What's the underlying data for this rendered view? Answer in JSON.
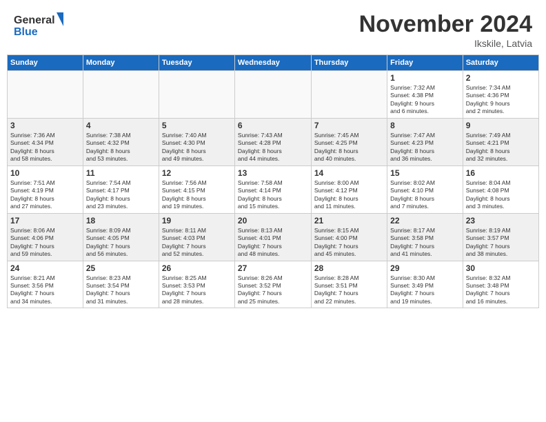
{
  "header": {
    "logo_line1": "General",
    "logo_line2": "Blue",
    "month": "November 2024",
    "location": "Ikskile, Latvia"
  },
  "weekdays": [
    "Sunday",
    "Monday",
    "Tuesday",
    "Wednesday",
    "Thursday",
    "Friday",
    "Saturday"
  ],
  "weeks": [
    [
      {
        "day": "",
        "detail": "",
        "empty": true
      },
      {
        "day": "",
        "detail": "",
        "empty": true
      },
      {
        "day": "",
        "detail": "",
        "empty": true
      },
      {
        "day": "",
        "detail": "",
        "empty": true
      },
      {
        "day": "",
        "detail": "",
        "empty": true
      },
      {
        "day": "1",
        "detail": "Sunrise: 7:32 AM\nSunset: 4:38 PM\nDaylight: 9 hours\nand 6 minutes."
      },
      {
        "day": "2",
        "detail": "Sunrise: 7:34 AM\nSunset: 4:36 PM\nDaylight: 9 hours\nand 2 minutes."
      }
    ],
    [
      {
        "day": "3",
        "detail": "Sunrise: 7:36 AM\nSunset: 4:34 PM\nDaylight: 8 hours\nand 58 minutes."
      },
      {
        "day": "4",
        "detail": "Sunrise: 7:38 AM\nSunset: 4:32 PM\nDaylight: 8 hours\nand 53 minutes."
      },
      {
        "day": "5",
        "detail": "Sunrise: 7:40 AM\nSunset: 4:30 PM\nDaylight: 8 hours\nand 49 minutes."
      },
      {
        "day": "6",
        "detail": "Sunrise: 7:43 AM\nSunset: 4:28 PM\nDaylight: 8 hours\nand 44 minutes."
      },
      {
        "day": "7",
        "detail": "Sunrise: 7:45 AM\nSunset: 4:25 PM\nDaylight: 8 hours\nand 40 minutes."
      },
      {
        "day": "8",
        "detail": "Sunrise: 7:47 AM\nSunset: 4:23 PM\nDaylight: 8 hours\nand 36 minutes."
      },
      {
        "day": "9",
        "detail": "Sunrise: 7:49 AM\nSunset: 4:21 PM\nDaylight: 8 hours\nand 32 minutes."
      }
    ],
    [
      {
        "day": "10",
        "detail": "Sunrise: 7:51 AM\nSunset: 4:19 PM\nDaylight: 8 hours\nand 27 minutes."
      },
      {
        "day": "11",
        "detail": "Sunrise: 7:54 AM\nSunset: 4:17 PM\nDaylight: 8 hours\nand 23 minutes."
      },
      {
        "day": "12",
        "detail": "Sunrise: 7:56 AM\nSunset: 4:15 PM\nDaylight: 8 hours\nand 19 minutes."
      },
      {
        "day": "13",
        "detail": "Sunrise: 7:58 AM\nSunset: 4:14 PM\nDaylight: 8 hours\nand 15 minutes."
      },
      {
        "day": "14",
        "detail": "Sunrise: 8:00 AM\nSunset: 4:12 PM\nDaylight: 8 hours\nand 11 minutes."
      },
      {
        "day": "15",
        "detail": "Sunrise: 8:02 AM\nSunset: 4:10 PM\nDaylight: 8 hours\nand 7 minutes."
      },
      {
        "day": "16",
        "detail": "Sunrise: 8:04 AM\nSunset: 4:08 PM\nDaylight: 8 hours\nand 3 minutes."
      }
    ],
    [
      {
        "day": "17",
        "detail": "Sunrise: 8:06 AM\nSunset: 4:06 PM\nDaylight: 7 hours\nand 59 minutes."
      },
      {
        "day": "18",
        "detail": "Sunrise: 8:09 AM\nSunset: 4:05 PM\nDaylight: 7 hours\nand 56 minutes."
      },
      {
        "day": "19",
        "detail": "Sunrise: 8:11 AM\nSunset: 4:03 PM\nDaylight: 7 hours\nand 52 minutes."
      },
      {
        "day": "20",
        "detail": "Sunrise: 8:13 AM\nSunset: 4:01 PM\nDaylight: 7 hours\nand 48 minutes."
      },
      {
        "day": "21",
        "detail": "Sunrise: 8:15 AM\nSunset: 4:00 PM\nDaylight: 7 hours\nand 45 minutes."
      },
      {
        "day": "22",
        "detail": "Sunrise: 8:17 AM\nSunset: 3:58 PM\nDaylight: 7 hours\nand 41 minutes."
      },
      {
        "day": "23",
        "detail": "Sunrise: 8:19 AM\nSunset: 3:57 PM\nDaylight: 7 hours\nand 38 minutes."
      }
    ],
    [
      {
        "day": "24",
        "detail": "Sunrise: 8:21 AM\nSunset: 3:56 PM\nDaylight: 7 hours\nand 34 minutes."
      },
      {
        "day": "25",
        "detail": "Sunrise: 8:23 AM\nSunset: 3:54 PM\nDaylight: 7 hours\nand 31 minutes."
      },
      {
        "day": "26",
        "detail": "Sunrise: 8:25 AM\nSunset: 3:53 PM\nDaylight: 7 hours\nand 28 minutes."
      },
      {
        "day": "27",
        "detail": "Sunrise: 8:26 AM\nSunset: 3:52 PM\nDaylight: 7 hours\nand 25 minutes."
      },
      {
        "day": "28",
        "detail": "Sunrise: 8:28 AM\nSunset: 3:51 PM\nDaylight: 7 hours\nand 22 minutes."
      },
      {
        "day": "29",
        "detail": "Sunrise: 8:30 AM\nSunset: 3:49 PM\nDaylight: 7 hours\nand 19 minutes."
      },
      {
        "day": "30",
        "detail": "Sunrise: 8:32 AM\nSunset: 3:48 PM\nDaylight: 7 hours\nand 16 minutes."
      }
    ]
  ]
}
